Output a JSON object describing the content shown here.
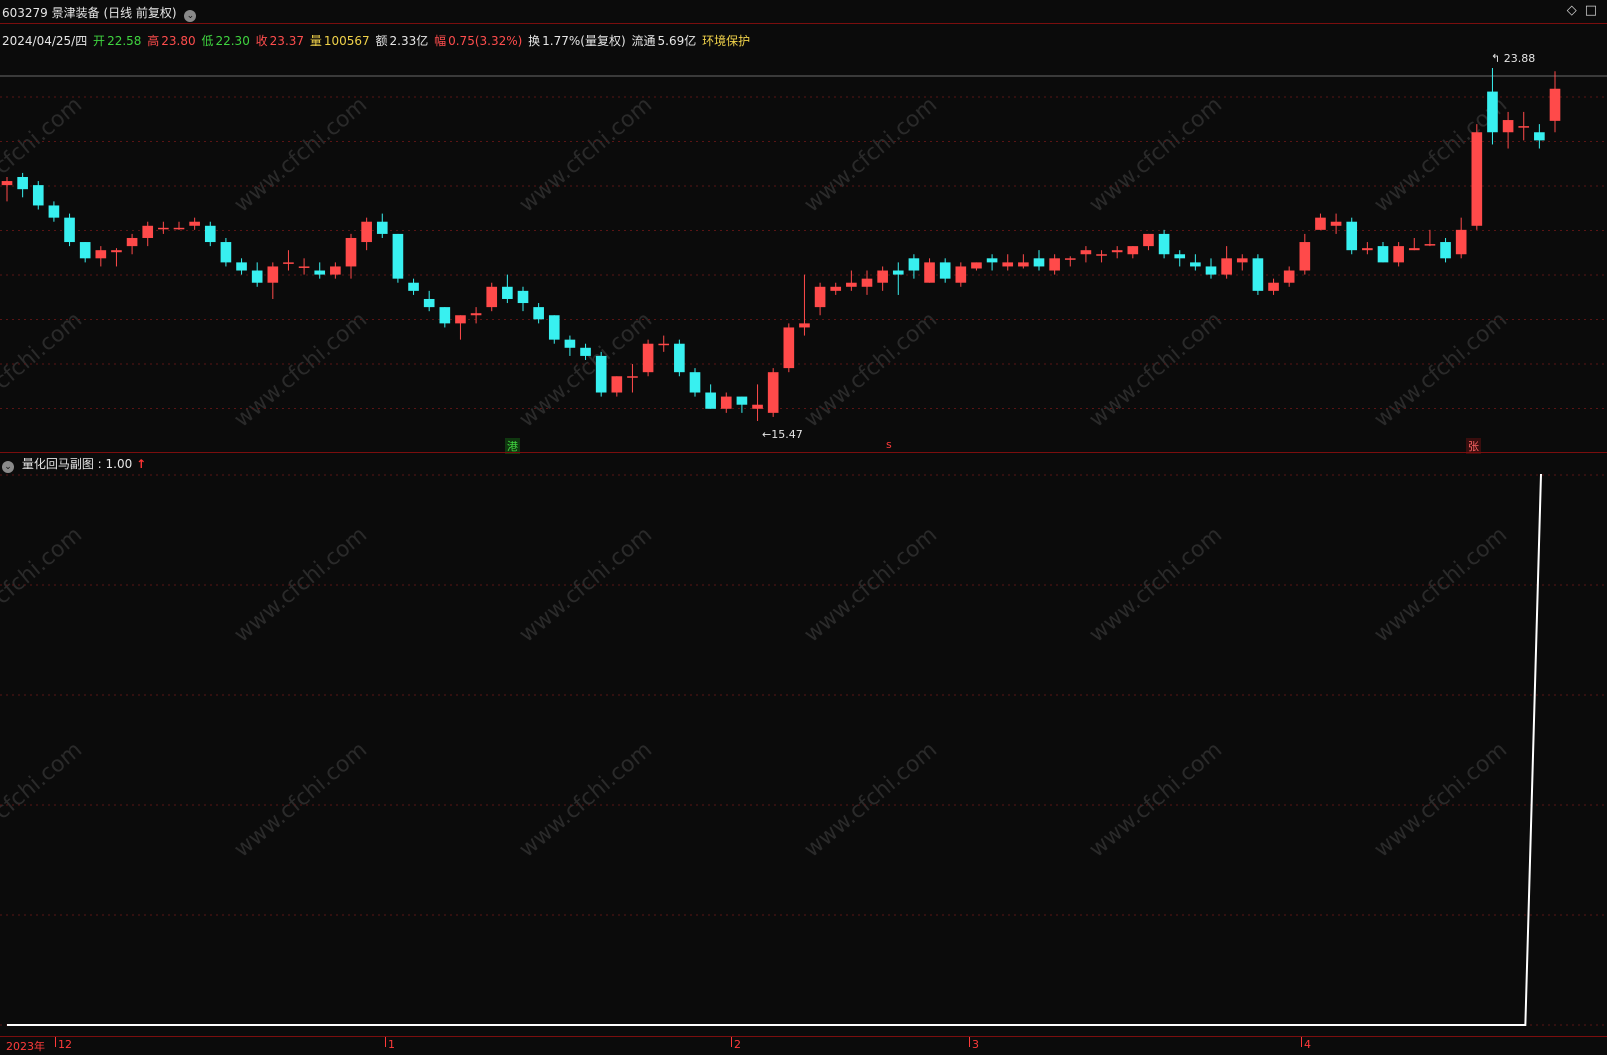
{
  "header": {
    "title": "603279 景津装备 (日线 前复权)",
    "chevron_glyph": "⌄",
    "window_icons": "◇□"
  },
  "infobar": {
    "date": "2024/04/25/四",
    "open_label": "开",
    "open_value": "22.58",
    "high_label": "高",
    "high_value": "23.80",
    "low_label": "低",
    "low_value": "22.30",
    "close_label": "收",
    "close_value": "23.37",
    "volume_label": "量",
    "volume_value": "100567",
    "amount_label": "额",
    "amount_value": "2.33亿",
    "change_label": "幅",
    "change_value": "0.75(3.32%)",
    "turnover_label": "换",
    "turnover_value": "1.77%(量复权)",
    "float_label": "流通",
    "float_value": "5.69亿",
    "env": "环境保护"
  },
  "markers": {
    "gang": "港",
    "s": "s",
    "zhang": "张",
    "high_label": "23.88",
    "low_label": "15.47"
  },
  "subpanel": {
    "title": "量化回马副图",
    "value": ": 1.00",
    "arrow": "↑"
  },
  "timeaxis": {
    "labels": [
      "2023年",
      "12",
      "1",
      "2",
      "3",
      "4"
    ]
  },
  "watermark": "www.cfchi.com",
  "colors": {
    "up": "#ff4a4a",
    "down": "#38f0f0",
    "grid": "#5a1515",
    "background": "#0b0b0b",
    "indicator_line": "#ffffff"
  },
  "chart_data": {
    "type": "candlestick",
    "price_high": 23.88,
    "price_low": 15.47,
    "candles": [
      {
        "o": 21.0,
        "h": 21.2,
        "l": 20.6,
        "c": 21.1
      },
      {
        "o": 21.2,
        "h": 21.3,
        "l": 20.7,
        "c": 20.9
      },
      {
        "o": 21.0,
        "h": 21.1,
        "l": 20.4,
        "c": 20.5
      },
      {
        "o": 20.5,
        "h": 20.6,
        "l": 20.1,
        "c": 20.2
      },
      {
        "o": 20.2,
        "h": 20.3,
        "l": 19.5,
        "c": 19.6
      },
      {
        "o": 19.6,
        "h": 19.6,
        "l": 19.1,
        "c": 19.2
      },
      {
        "o": 19.2,
        "h": 19.5,
        "l": 19.0,
        "c": 19.4
      },
      {
        "o": 19.35,
        "h": 19.45,
        "l": 19.0,
        "c": 19.4
      },
      {
        "o": 19.5,
        "h": 19.8,
        "l": 19.3,
        "c": 19.7
      },
      {
        "o": 19.7,
        "h": 20.1,
        "l": 19.5,
        "c": 20.0
      },
      {
        "o": 19.95,
        "h": 20.1,
        "l": 19.8,
        "c": 19.95
      },
      {
        "o": 19.95,
        "h": 20.1,
        "l": 19.9,
        "c": 19.95
      },
      {
        "o": 20.0,
        "h": 20.2,
        "l": 19.9,
        "c": 20.1
      },
      {
        "o": 20.0,
        "h": 20.1,
        "l": 19.5,
        "c": 19.6
      },
      {
        "o": 19.6,
        "h": 19.7,
        "l": 19.0,
        "c": 19.1
      },
      {
        "o": 19.1,
        "h": 19.2,
        "l": 18.8,
        "c": 18.9
      },
      {
        "o": 18.9,
        "h": 19.1,
        "l": 18.5,
        "c": 18.6
      },
      {
        "o": 18.6,
        "h": 19.1,
        "l": 18.2,
        "c": 19.0
      },
      {
        "o": 19.1,
        "h": 19.4,
        "l": 18.9,
        "c": 19.1
      },
      {
        "o": 19.0,
        "h": 19.2,
        "l": 18.8,
        "c": 19.0
      },
      {
        "o": 18.9,
        "h": 19.1,
        "l": 18.7,
        "c": 18.8
      },
      {
        "o": 18.8,
        "h": 19.1,
        "l": 18.7,
        "c": 19.0
      },
      {
        "o": 19.0,
        "h": 19.8,
        "l": 18.7,
        "c": 19.7
      },
      {
        "o": 19.6,
        "h": 20.2,
        "l": 19.4,
        "c": 20.1
      },
      {
        "o": 20.1,
        "h": 20.3,
        "l": 19.7,
        "c": 19.8
      },
      {
        "o": 19.8,
        "h": 19.8,
        "l": 18.6,
        "c": 18.7
      },
      {
        "o": 18.6,
        "h": 18.7,
        "l": 18.3,
        "c": 18.4
      },
      {
        "o": 18.2,
        "h": 18.4,
        "l": 17.9,
        "c": 18.0
      },
      {
        "o": 18.0,
        "h": 18.0,
        "l": 17.5,
        "c": 17.6
      },
      {
        "o": 17.6,
        "h": 17.8,
        "l": 17.2,
        "c": 17.8
      },
      {
        "o": 17.8,
        "h": 18.0,
        "l": 17.6,
        "c": 17.85
      },
      {
        "o": 18.0,
        "h": 18.6,
        "l": 17.9,
        "c": 18.5
      },
      {
        "o": 18.5,
        "h": 18.8,
        "l": 18.1,
        "c": 18.2
      },
      {
        "o": 18.4,
        "h": 18.5,
        "l": 17.9,
        "c": 18.1
      },
      {
        "o": 18.0,
        "h": 18.1,
        "l": 17.6,
        "c": 17.7
      },
      {
        "o": 17.8,
        "h": 17.8,
        "l": 17.1,
        "c": 17.2
      },
      {
        "o": 17.2,
        "h": 17.3,
        "l": 16.8,
        "c": 17.0
      },
      {
        "o": 17.0,
        "h": 17.1,
        "l": 16.7,
        "c": 16.8
      },
      {
        "o": 16.8,
        "h": 16.9,
        "l": 15.8,
        "c": 15.9
      },
      {
        "o": 15.9,
        "h": 16.3,
        "l": 15.8,
        "c": 16.3
      },
      {
        "o": 16.3,
        "h": 16.6,
        "l": 15.9,
        "c": 16.3
      },
      {
        "o": 16.4,
        "h": 17.2,
        "l": 16.3,
        "c": 17.1
      },
      {
        "o": 17.1,
        "h": 17.3,
        "l": 16.9,
        "c": 17.1
      },
      {
        "o": 17.1,
        "h": 17.2,
        "l": 16.3,
        "c": 16.4
      },
      {
        "o": 16.4,
        "h": 16.5,
        "l": 15.8,
        "c": 15.9
      },
      {
        "o": 15.9,
        "h": 16.1,
        "l": 15.5,
        "c": 15.5
      },
      {
        "o": 15.5,
        "h": 15.9,
        "l": 15.4,
        "c": 15.8
      },
      {
        "o": 15.8,
        "h": 15.8,
        "l": 15.4,
        "c": 15.6
      },
      {
        "o": 15.5,
        "h": 16.1,
        "l": 15.2,
        "c": 15.6
      },
      {
        "o": 15.4,
        "h": 16.5,
        "l": 15.3,
        "c": 16.4
      },
      {
        "o": 16.5,
        "h": 17.6,
        "l": 16.4,
        "c": 17.5
      },
      {
        "o": 17.5,
        "h": 18.8,
        "l": 17.3,
        "c": 17.6
      },
      {
        "o": 18.0,
        "h": 18.6,
        "l": 17.8,
        "c": 18.5
      },
      {
        "o": 18.4,
        "h": 18.6,
        "l": 18.3,
        "c": 18.5
      },
      {
        "o": 18.5,
        "h": 18.9,
        "l": 18.4,
        "c": 18.6
      },
      {
        "o": 18.5,
        "h": 18.9,
        "l": 18.3,
        "c": 18.7
      },
      {
        "o": 18.6,
        "h": 19.0,
        "l": 18.4,
        "c": 18.9
      },
      {
        "o": 18.9,
        "h": 19.1,
        "l": 18.3,
        "c": 18.8
      },
      {
        "o": 19.2,
        "h": 19.3,
        "l": 18.7,
        "c": 18.9
      },
      {
        "o": 18.6,
        "h": 19.2,
        "l": 18.6,
        "c": 19.1
      },
      {
        "o": 19.1,
        "h": 19.2,
        "l": 18.6,
        "c": 18.7
      },
      {
        "o": 18.6,
        "h": 19.1,
        "l": 18.5,
        "c": 19.0
      },
      {
        "o": 18.95,
        "h": 19.1,
        "l": 18.9,
        "c": 19.1
      },
      {
        "o": 19.2,
        "h": 19.3,
        "l": 18.9,
        "c": 19.1
      },
      {
        "o": 19.0,
        "h": 19.3,
        "l": 18.9,
        "c": 19.1
      },
      {
        "o": 19.0,
        "h": 19.3,
        "l": 18.95,
        "c": 19.1
      },
      {
        "o": 19.2,
        "h": 19.4,
        "l": 18.9,
        "c": 19.0
      },
      {
        "o": 18.9,
        "h": 19.3,
        "l": 18.8,
        "c": 19.2
      },
      {
        "o": 19.2,
        "h": 19.25,
        "l": 19.0,
        "c": 19.2
      },
      {
        "o": 19.3,
        "h": 19.5,
        "l": 19.1,
        "c": 19.4
      },
      {
        "o": 19.3,
        "h": 19.4,
        "l": 19.1,
        "c": 19.3
      },
      {
        "o": 19.35,
        "h": 19.5,
        "l": 19.2,
        "c": 19.4
      },
      {
        "o": 19.3,
        "h": 19.5,
        "l": 19.2,
        "c": 19.5
      },
      {
        "o": 19.5,
        "h": 19.8,
        "l": 19.4,
        "c": 19.8
      },
      {
        "o": 19.8,
        "h": 19.9,
        "l": 19.2,
        "c": 19.3
      },
      {
        "o": 19.3,
        "h": 19.4,
        "l": 19.0,
        "c": 19.2
      },
      {
        "o": 19.1,
        "h": 19.3,
        "l": 18.9,
        "c": 19.0
      },
      {
        "o": 19.0,
        "h": 19.2,
        "l": 18.7,
        "c": 18.8
      },
      {
        "o": 18.8,
        "h": 19.5,
        "l": 18.7,
        "c": 19.2
      },
      {
        "o": 19.1,
        "h": 19.3,
        "l": 18.9,
        "c": 19.2
      },
      {
        "o": 19.2,
        "h": 19.3,
        "l": 18.3,
        "c": 18.4
      },
      {
        "o": 18.4,
        "h": 18.7,
        "l": 18.3,
        "c": 18.6
      },
      {
        "o": 18.6,
        "h": 19.0,
        "l": 18.5,
        "c": 18.9
      },
      {
        "o": 18.9,
        "h": 19.8,
        "l": 18.8,
        "c": 19.6
      },
      {
        "o": 19.9,
        "h": 20.3,
        "l": 19.9,
        "c": 20.2
      },
      {
        "o": 20.0,
        "h": 20.3,
        "l": 19.8,
        "c": 20.1
      },
      {
        "o": 20.1,
        "h": 20.2,
        "l": 19.3,
        "c": 19.4
      },
      {
        "o": 19.4,
        "h": 19.6,
        "l": 19.3,
        "c": 19.45
      },
      {
        "o": 19.5,
        "h": 19.6,
        "l": 19.1,
        "c": 19.1
      },
      {
        "o": 19.1,
        "h": 19.6,
        "l": 19.0,
        "c": 19.5
      },
      {
        "o": 19.4,
        "h": 19.7,
        "l": 19.4,
        "c": 19.45
      },
      {
        "o": 19.55,
        "h": 19.9,
        "l": 19.5,
        "c": 19.55
      },
      {
        "o": 19.6,
        "h": 19.7,
        "l": 19.1,
        "c": 19.2
      },
      {
        "o": 19.3,
        "h": 20.2,
        "l": 19.2,
        "c": 19.9
      },
      {
        "o": 20.0,
        "h": 22.5,
        "l": 19.9,
        "c": 22.3
      },
      {
        "o": 23.3,
        "h": 23.88,
        "l": 22.0,
        "c": 22.3
      },
      {
        "o": 22.3,
        "h": 22.8,
        "l": 21.9,
        "c": 22.6
      },
      {
        "o": 22.45,
        "h": 22.8,
        "l": 22.1,
        "c": 22.45
      },
      {
        "o": 22.3,
        "h": 22.5,
        "l": 21.9,
        "c": 22.1
      },
      {
        "o": 22.58,
        "h": 23.8,
        "l": 22.3,
        "c": 23.37
      }
    ],
    "subchart": {
      "name": "量化回马副图",
      "value": 1.0,
      "ylim": [
        0,
        1
      ],
      "series": [
        0,
        0,
        0,
        0,
        0,
        0,
        0,
        0,
        0,
        0,
        0,
        0,
        0,
        0,
        0,
        0,
        0,
        0,
        0,
        0,
        0,
        0,
        0,
        0,
        0,
        0,
        0,
        0,
        0,
        0,
        0,
        0,
        0,
        0,
        0,
        0,
        0,
        0,
        0,
        0,
        0,
        0,
        0,
        0,
        0,
        0,
        0,
        0,
        0,
        0,
        0,
        0,
        0,
        0,
        0,
        0,
        0,
        0,
        0,
        0,
        0,
        0,
        0,
        0,
        0,
        0,
        0,
        0,
        0,
        0,
        0,
        0,
        0,
        0,
        0,
        0,
        0,
        0,
        0,
        0,
        0,
        0,
        0,
        0,
        0,
        0,
        0,
        0,
        0,
        0,
        0,
        0,
        0,
        0,
        0,
        0,
        0,
        0,
        1
      ]
    }
  }
}
